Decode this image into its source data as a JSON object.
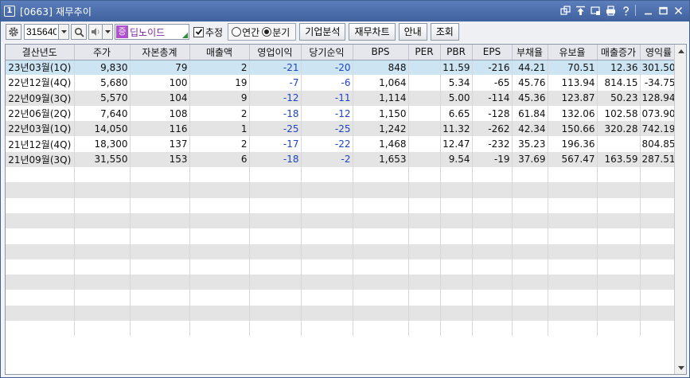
{
  "window": {
    "number": "1",
    "code": "[0663]",
    "title": "재무추이"
  },
  "toolbar": {
    "stock_code": "315640",
    "stock_badge": "증",
    "stock_name": "딥노이드",
    "estimate_label": "추정",
    "estimate_checked": true,
    "annual_label": "연간",
    "quarter_label": "분기",
    "selected_period": "quarter",
    "buttons": [
      "기업분석",
      "재무차트",
      "안내",
      "조회"
    ]
  },
  "table": {
    "columns": [
      "결산년도",
      "주가",
      "자본총계",
      "매출액",
      "영업이익",
      "당기순익",
      "BPS",
      "PER",
      "PBR",
      "EPS",
      "부채율",
      "유보율",
      "매출증가",
      "영익률"
    ],
    "rows": [
      [
        "23년03월(1Q)",
        "9,830",
        "79",
        "2",
        "-21",
        "-20",
        "848",
        "",
        "11.59",
        "-216",
        "44.21",
        "70.51",
        "12.36",
        "301.50"
      ],
      [
        "22년12월(4Q)",
        "5,680",
        "100",
        "19",
        "-7",
        "-6",
        "1,064",
        "",
        "5.34",
        "-65",
        "45.76",
        "113.94",
        "814.15",
        "-34.75"
      ],
      [
        "22년09월(3Q)",
        "5,570",
        "104",
        "9",
        "-12",
        "-11",
        "1,114",
        "",
        "5.00",
        "-114",
        "45.36",
        "123.87",
        "50.23",
        "128.94"
      ],
      [
        "22년06월(2Q)",
        "7,640",
        "108",
        "2",
        "-18",
        "-12",
        "1,150",
        "",
        "6.65",
        "-128",
        "61.84",
        "132.06",
        "102.58",
        "073.90"
      ],
      [
        "22년03월(1Q)",
        "14,050",
        "116",
        "1",
        "-25",
        "-25",
        "1,242",
        "",
        "11.32",
        "-262",
        "42.34",
        "150.66",
        "320.28",
        "742.19"
      ],
      [
        "21년12월(4Q)",
        "18,300",
        "137",
        "2",
        "-17",
        "-22",
        "1,468",
        "",
        "12.47",
        "-232",
        "35.23",
        "196.36",
        "",
        "804.85"
      ],
      [
        "21년09월(3Q)",
        "31,550",
        "153",
        "6",
        "-18",
        "-2",
        "1,653",
        "",
        "9.54",
        "-19",
        "37.69",
        "567.47",
        "163.59",
        "287.51"
      ]
    ],
    "blue_columns": [
      4,
      5
    ]
  },
  "colors": {
    "title_bar": "#4a6dab",
    "selected_row": "#cde4f3",
    "negative_text": "#1c44c7",
    "stock_badge": "#b04fd0"
  }
}
